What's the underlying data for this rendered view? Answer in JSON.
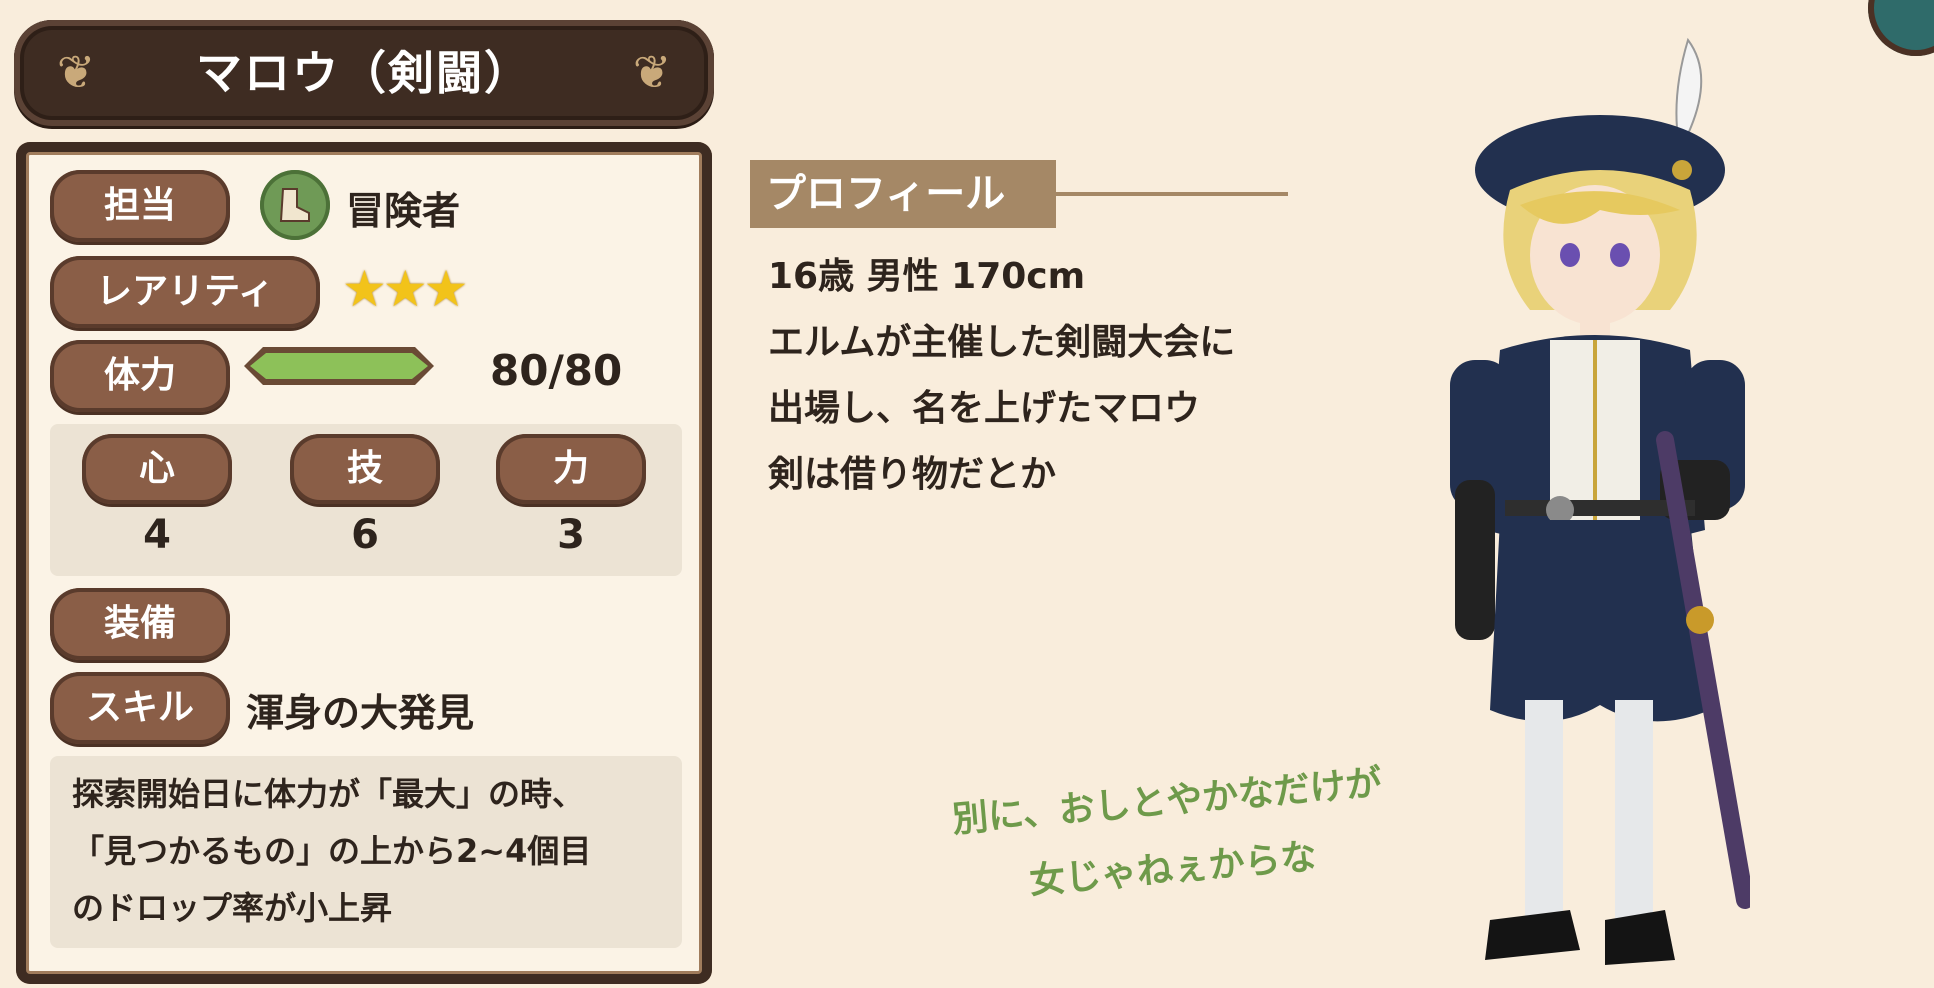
{
  "title": "マロウ（剣闘）",
  "stats_panel": {
    "role": {
      "label": "担当",
      "value": "冒険者",
      "icon": "boot-icon"
    },
    "rarity": {
      "label": "レアリティ",
      "stars": 3
    },
    "hp": {
      "label": "体力",
      "value_text": "80/80",
      "fill_fraction": 1.0,
      "bar_color": "#8dc159"
    },
    "attributes": [
      {
        "label": "心",
        "value": "4"
      },
      {
        "label": "技",
        "value": "6"
      },
      {
        "label": "力",
        "value": "3"
      }
    ],
    "equipment": {
      "label": "装備"
    },
    "skill": {
      "label": "スキル",
      "name": "渾身の大発見",
      "description_lines": [
        "探索開始日に体力が「最大」の時、",
        "「見つかるもの」の上から2~4個目",
        "のドロップ率が小上昇"
      ]
    }
  },
  "profile": {
    "header": "プロフィール",
    "lines": [
      "16歳 男性 170cm",
      "エルムが主催した剣闘大会に",
      "出場し、名を上げたマロウ",
      "剣は借り物だとか"
    ]
  },
  "quote_lines": [
    "別に、おしとやかなだけが",
    "女じゃねぇからな"
  ],
  "colors": {
    "background": "#f9eddc",
    "banner": "#3e2c22",
    "label_pill": "#8a5e47",
    "quote": "#6e9a4a",
    "profile_header": "#a58866"
  }
}
